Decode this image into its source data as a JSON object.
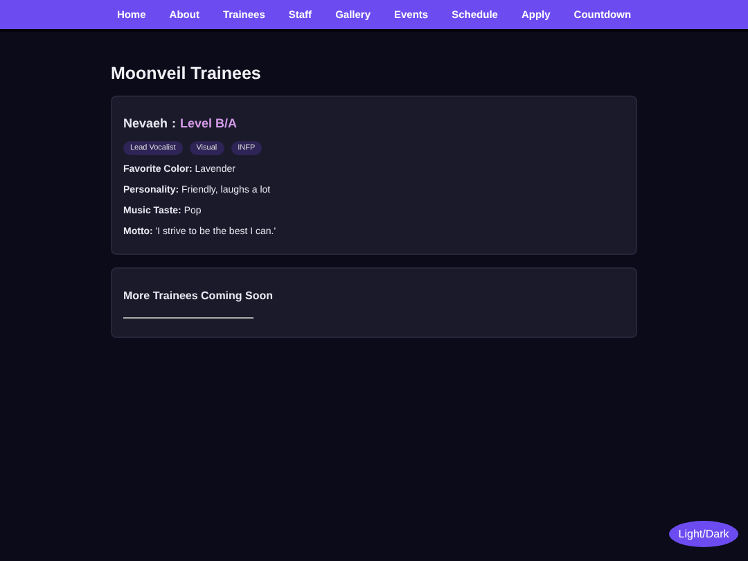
{
  "nav": [
    "Home",
    "About",
    "Trainees",
    "Staff",
    "Gallery",
    "Events",
    "Schedule",
    "Apply",
    "Countdown"
  ],
  "heading": "Moonveil Trainees",
  "trainees": [
    {
      "name": "Nevaeh",
      "separator": ":",
      "level": "Level B/A",
      "tags": [
        "Lead Vocalist",
        "Visual",
        "INFP"
      ],
      "facts": [
        {
          "label": "Favorite Color:",
          "value": "Lavender"
        },
        {
          "label": "Personality:",
          "value": "Friendly, laughs a lot"
        },
        {
          "label": "Music Taste:",
          "value": "Pop"
        },
        {
          "label": "Motto:",
          "value": "'I strive to be the best I can.'"
        }
      ]
    }
  ],
  "coming_soon": "More Trainees Coming Soon",
  "theme_button": "Light/Dark"
}
